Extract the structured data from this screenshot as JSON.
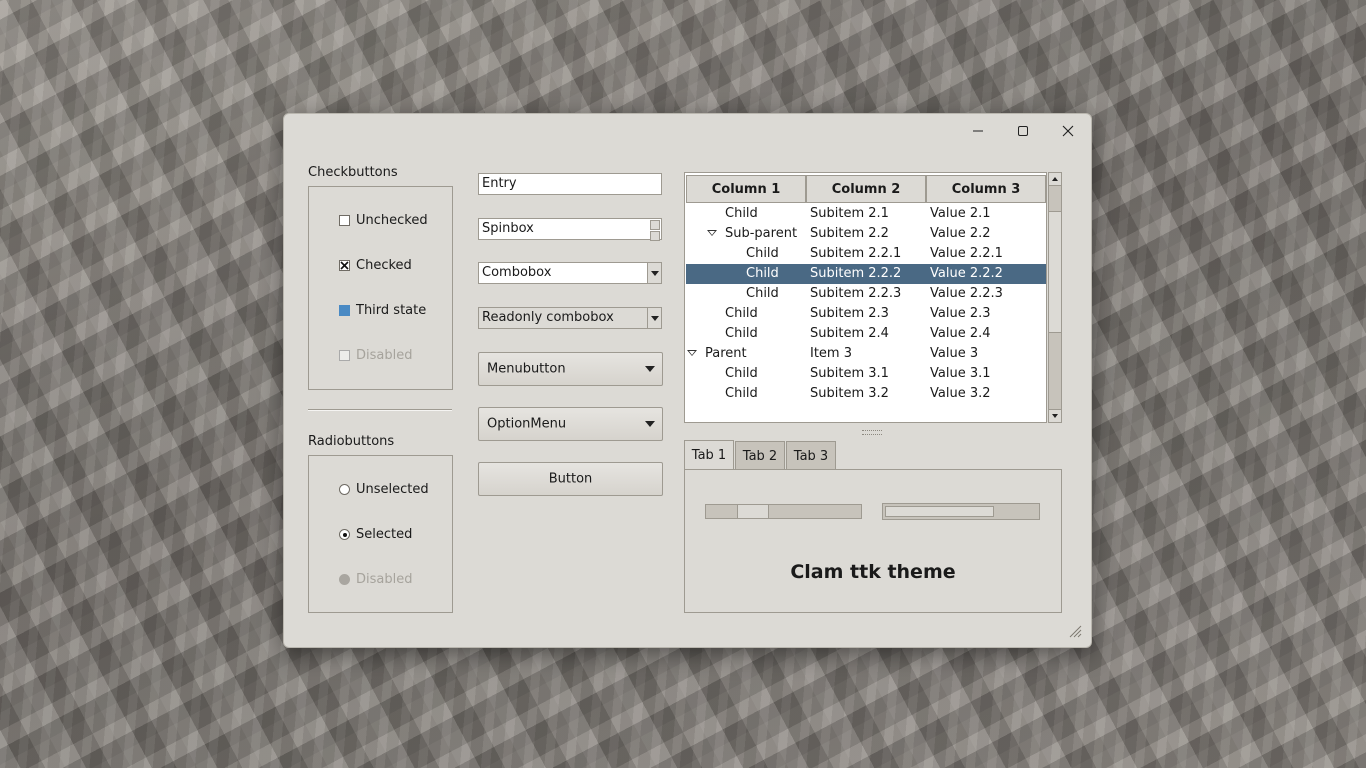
{
  "checkbuttons": {
    "title": "Checkbuttons",
    "items": [
      {
        "label": "Unchecked",
        "state": "unchecked"
      },
      {
        "label": "Checked",
        "state": "checked"
      },
      {
        "label": "Third state",
        "state": "indeterminate"
      },
      {
        "label": "Disabled",
        "state": "disabled"
      }
    ]
  },
  "radiobuttons": {
    "title": "Radiobuttons",
    "items": [
      {
        "label": "Unselected",
        "state": "unselected"
      },
      {
        "label": "Selected",
        "state": "selected"
      },
      {
        "label": "Disabled",
        "state": "disabled"
      }
    ]
  },
  "widgets": {
    "entry": "Entry",
    "spinbox": "Spinbox",
    "combobox": "Combobox",
    "readonly_combobox": "Readonly combobox",
    "menubutton": "Menubutton",
    "optionmenu": "OptionMenu",
    "button": "Button"
  },
  "tree": {
    "columns": [
      "Column 1",
      "Column 2",
      "Column 3"
    ],
    "rows": [
      {
        "c1": "Child",
        "c2": "Subitem 2.1",
        "c3": "Value 2.1",
        "level": 1,
        "expander": false,
        "selected": false
      },
      {
        "c1": "Sub-parent",
        "c2": "Subitem 2.2",
        "c3": "Value 2.2",
        "level": 1,
        "expander": true,
        "selected": false
      },
      {
        "c1": "Child",
        "c2": "Subitem 2.2.1",
        "c3": "Value 2.2.1",
        "level": 2,
        "expander": false,
        "selected": false
      },
      {
        "c1": "Child",
        "c2": "Subitem 2.2.2",
        "c3": "Value 2.2.2",
        "level": 2,
        "expander": false,
        "selected": true
      },
      {
        "c1": "Child",
        "c2": "Subitem 2.2.3",
        "c3": "Value 2.2.3",
        "level": 2,
        "expander": false,
        "selected": false
      },
      {
        "c1": "Child",
        "c2": "Subitem 2.3",
        "c3": "Value 2.3",
        "level": 1,
        "expander": false,
        "selected": false
      },
      {
        "c1": "Child",
        "c2": "Subitem 2.4",
        "c3": "Value 2.4",
        "level": 1,
        "expander": false,
        "selected": false
      },
      {
        "c1": "Parent",
        "c2": "Item 3",
        "c3": "Value 3",
        "level": 0,
        "expander": true,
        "selected": false
      },
      {
        "c1": "Child",
        "c2": "Subitem 3.1",
        "c3": "Value 3.1",
        "level": 1,
        "expander": false,
        "selected": false
      },
      {
        "c1": "Child",
        "c2": "Subitem 3.2",
        "c3": "Value 3.2",
        "level": 1,
        "expander": false,
        "selected": false
      }
    ]
  },
  "notebook": {
    "tabs": [
      "Tab 1",
      "Tab 2",
      "Tab 3"
    ],
    "active_tab": 0,
    "scale_value": 0.25,
    "progress_value": 0.72,
    "caption": "Clam ttk theme"
  },
  "colors": {
    "window_bg": "#dcdad5",
    "selection": "#4a6984",
    "third_state": "#4a8ac4"
  }
}
